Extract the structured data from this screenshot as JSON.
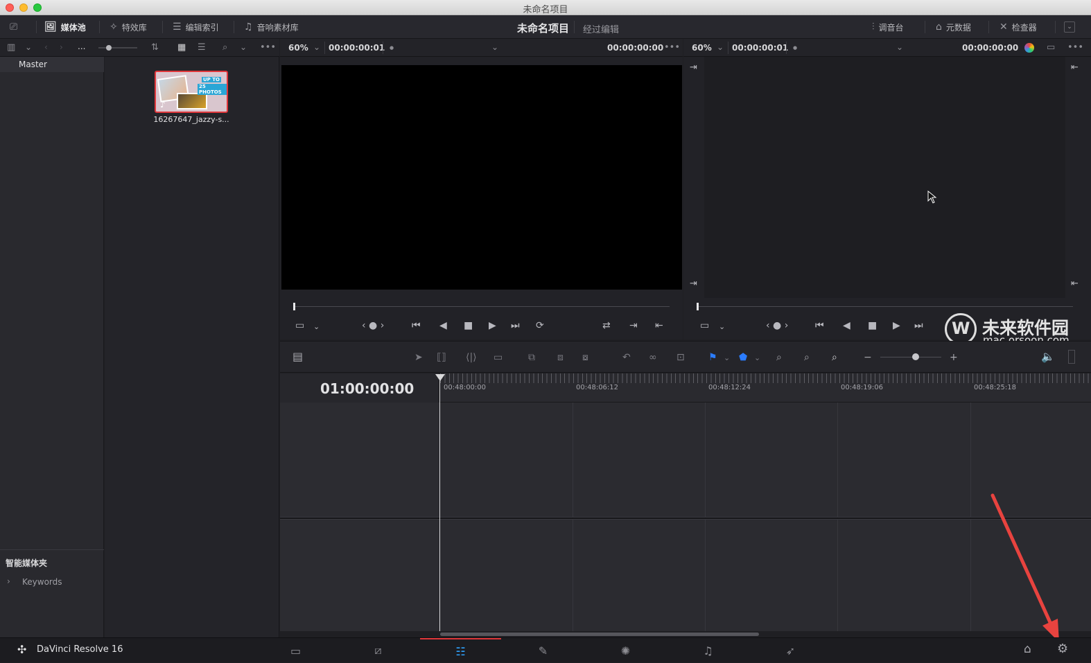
{
  "window": {
    "title": "未命名项目"
  },
  "toolbar": {
    "media_pool": "媒体池",
    "effects": "特效库",
    "edit_index": "编辑索引",
    "sound_library": "音响素材库",
    "project_title": "未命名项目",
    "project_subtitle": "经过编辑",
    "mixer": "调音台",
    "metadata": "元数据",
    "inspector": "检查器"
  },
  "media_bar": {
    "breadcrumb": "..."
  },
  "source_viewer": {
    "zoom": "60%",
    "timecode_in": "00:00:00:01",
    "timecode_out": "00:00:00:00"
  },
  "timeline_viewer": {
    "zoom": "60%",
    "timecode_in": "00:00:00:01",
    "timecode_out": "00:00:00:00"
  },
  "bins": {
    "master": "Master",
    "smart_bins_title": "智能媒体夹",
    "keywords": "Keywords"
  },
  "media_pool": {
    "clips": [
      {
        "name": "16267647_jazzy-s...",
        "thumb_text_1": "UP TO",
        "thumb_text_2": "25 PHOTOS"
      }
    ]
  },
  "timeline": {
    "current_timecode": "01:00:00:00",
    "ruler_labels": [
      "00:48:00:00",
      "00:48:06:12",
      "00:48:12:24",
      "00:48:19:06",
      "00:48:25:18"
    ]
  },
  "watermark": {
    "title": "未来软件园",
    "url": "mac.orsoon.com"
  },
  "app": {
    "name": "DaVinci Resolve 16"
  },
  "colors": {
    "accent_red": "#e0373b",
    "flag_blue": "#2b7cff",
    "annotation_arrow": "#e8433f"
  }
}
